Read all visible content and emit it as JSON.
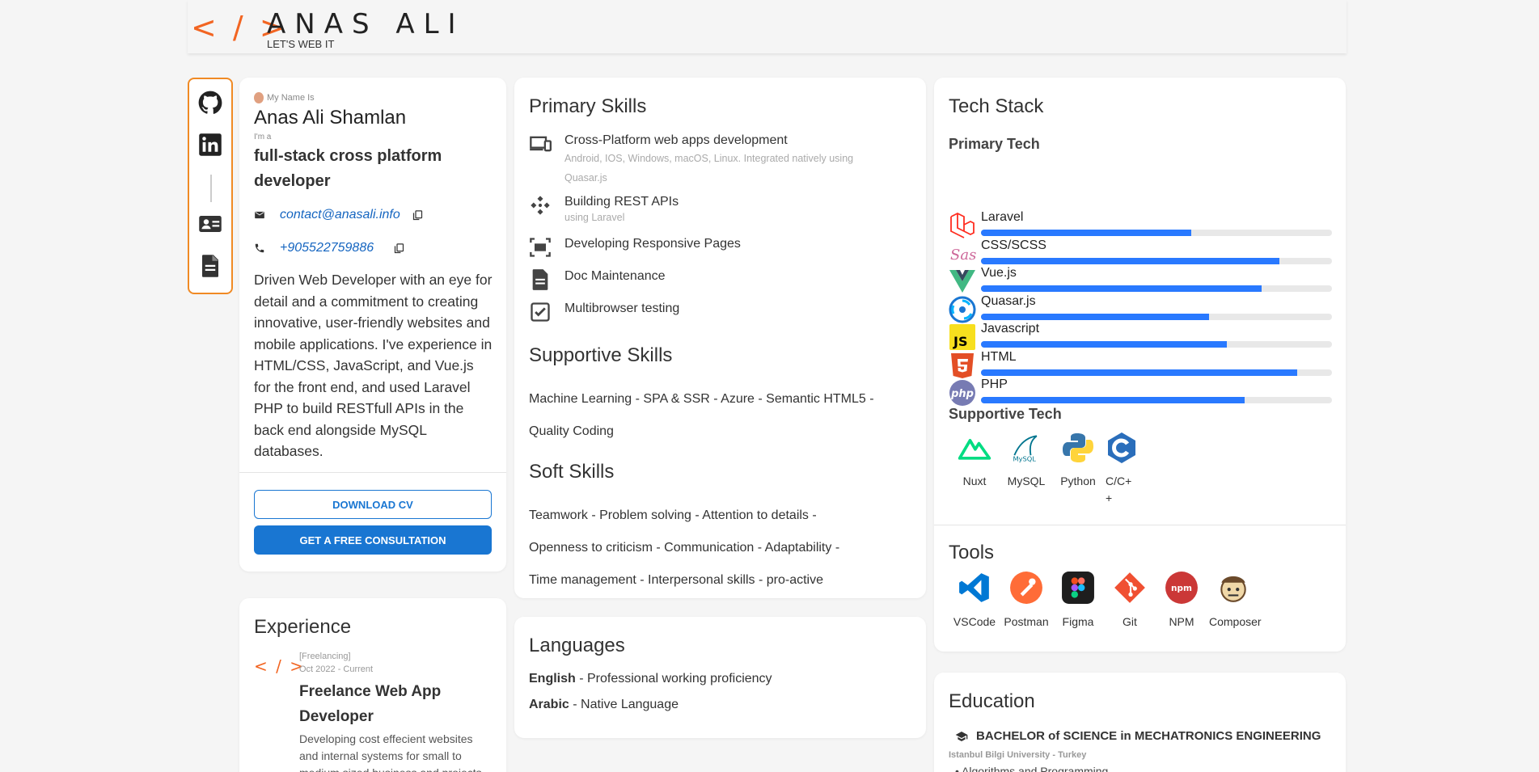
{
  "header": {
    "logo_brackets": "< / >",
    "name": "ANAS ALI",
    "tagline": "LET'S WEB IT"
  },
  "social": [
    "github-icon",
    "linkedin-icon",
    "contact-card-icon",
    "document-icon"
  ],
  "profile": {
    "name_caption": "My Name Is",
    "name": "Anas Ali Shamlan",
    "role_caption": "I'm a",
    "role": "full-stack cross platform developer",
    "email": "contact@anasali.info",
    "phone": "+905522759886",
    "description": "Driven Web Developer with an eye for detail and a commitment to creating innovative, user-friendly websites and mobile applications. I've experience in HTML/CSS, JavaScript, and Vue.js for the front end, and used Laravel PHP to build RESTfull APIs in the back end alongside MySQL databases.",
    "download_cv": "DOWNLOAD CV",
    "consultation": "GET A FREE CONSULTATION"
  },
  "skills": {
    "primary_title": "Primary Skills",
    "primary": [
      {
        "icon": "devices-icon",
        "title": "Cross-Platform web apps development",
        "sub": "Android, IOS, Windows, macOS, Linux. Integrated natively using Quasar.js"
      },
      {
        "icon": "api-icon",
        "title": "Building REST APIs",
        "sub": "using Laravel"
      },
      {
        "icon": "responsive-icon",
        "title": "Developing Responsive Pages",
        "sub": ""
      },
      {
        "icon": "doc-icon",
        "title": "Doc Maintenance",
        "sub": ""
      },
      {
        "icon": "checkbox-icon",
        "title": "Multibrowser testing",
        "sub": ""
      }
    ],
    "supportive_title": "Supportive Skills",
    "supportive_lines": [
      "Machine Learning - SPA & SSR - Azure - Semantic HTML5 -",
      "Quality Coding"
    ],
    "soft_title": "Soft Skills",
    "soft_lines": [
      "Teamwork - Problem solving - Attention to details -",
      "Openness to criticism - Communication - Adaptability -",
      "Time management - Interpersonal skills - pro-active"
    ]
  },
  "languages": {
    "title": "Languages",
    "items": [
      {
        "lang": "English",
        "level": " - Professional working proficiency"
      },
      {
        "lang": "Arabic",
        "level": " - Native Language"
      }
    ]
  },
  "tech": {
    "title": "Tech Stack",
    "primary_title": "Primary Tech",
    "primary": [
      {
        "name": "Laravel",
        "level": 0.6,
        "color": "#ff2d20"
      },
      {
        "name": "CSS/SCSS",
        "level": 0.85,
        "color": "#cd6799"
      },
      {
        "name": "Vue.js",
        "level": 0.8,
        "color": "#41b883"
      },
      {
        "name": "Quasar.js",
        "level": 0.65,
        "color": "#1976d2"
      },
      {
        "name": "Javascript",
        "level": 0.7,
        "color": "#f7df1e"
      },
      {
        "name": "HTML",
        "level": 0.9,
        "color": "#e34f26"
      },
      {
        "name": "PHP",
        "level": 0.75,
        "color": "#777bb3"
      }
    ],
    "supportive_title": "Supportive Tech",
    "supportive": [
      "Nuxt",
      "MySQL",
      "Python",
      "C/C++"
    ],
    "tools_title": "Tools",
    "tools": [
      "VSCode",
      "Postman",
      "Figma",
      "Git",
      "NPM",
      "Composer"
    ]
  },
  "experience": {
    "title": "Experience",
    "logo": "< / >",
    "type": "[Freelancing]",
    "period": "Oct 2022 - Current",
    "role": "Freelance Web App Developer",
    "desc": "Developing cost effecient websites and internal systems for small to medium sized business and projects"
  },
  "education": {
    "title": "Education",
    "degree": "BACHELOR of SCIENCE in MECHATRONICS ENGINEERING",
    "school": "Istanbul Bilgi University - Turkey",
    "course": "Algorithms and Programming"
  }
}
